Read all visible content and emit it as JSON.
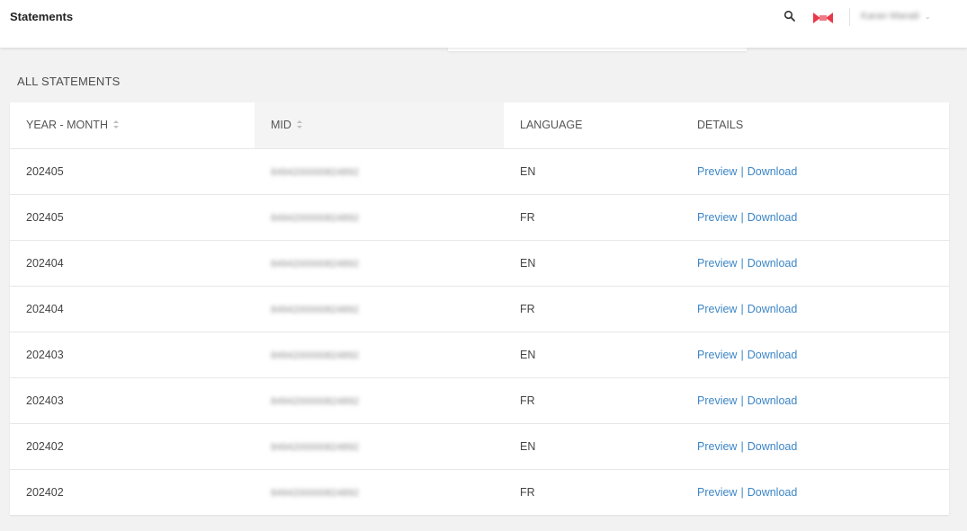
{
  "header": {
    "title": "Statements",
    "user_name": "Karan Manali",
    "chevron": "⌄"
  },
  "section_title": "ALL STATEMENTS",
  "table": {
    "columns": [
      "YEAR - MONTH",
      "MID",
      "LANGUAGE",
      "DETAILS"
    ],
    "rows": [
      {
        "year_month": "202405",
        "mid": "8494200000824892",
        "language": "EN",
        "preview": "Preview",
        "separator": "|",
        "download": "Download"
      },
      {
        "year_month": "202405",
        "mid": "8494200000824892",
        "language": "FR",
        "preview": "Preview",
        "separator": "|",
        "download": "Download"
      },
      {
        "year_month": "202404",
        "mid": "8494200000824892",
        "language": "EN",
        "preview": "Preview",
        "separator": "|",
        "download": "Download"
      },
      {
        "year_month": "202404",
        "mid": "8494200000824892",
        "language": "FR",
        "preview": "Preview",
        "separator": "|",
        "download": "Download"
      },
      {
        "year_month": "202403",
        "mid": "8494200000824892",
        "language": "EN",
        "preview": "Preview",
        "separator": "|",
        "download": "Download"
      },
      {
        "year_month": "202403",
        "mid": "8494200000824892",
        "language": "FR",
        "preview": "Preview",
        "separator": "|",
        "download": "Download"
      },
      {
        "year_month": "202402",
        "mid": "8494200000824892",
        "language": "EN",
        "preview": "Preview",
        "separator": "|",
        "download": "Download"
      },
      {
        "year_month": "202402",
        "mid": "8494200000824892",
        "language": "FR",
        "preview": "Preview",
        "separator": "|",
        "download": "Download"
      }
    ]
  },
  "colors": {
    "link": "#3d86c6",
    "brand_red": "#e8394a",
    "background": "#f2f2f2"
  },
  "icons": {
    "search": "search-icon",
    "brand": "brand-logo-icon",
    "sort": "sort-icon"
  }
}
